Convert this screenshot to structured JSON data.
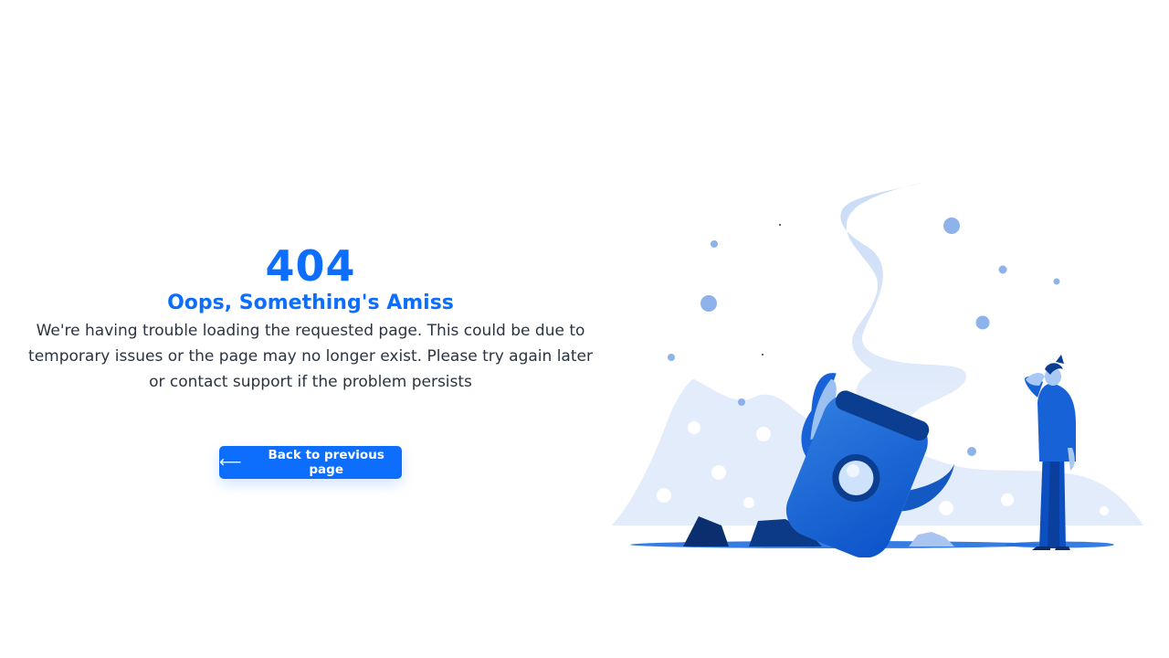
{
  "error": {
    "code": "404",
    "title": "Oops, Something's Amiss",
    "description": "We're having trouble loading the requested page. This could be due to temporary issues or the page may no longer exist. Please try again later or contact support if the problem persists"
  },
  "actions": {
    "back_label": "Back to previous page",
    "back_icon": "arrow-left-icon"
  },
  "illustration": {
    "subject": "crashed-rocket-with-person",
    "colors": {
      "primary": "#0d6efd",
      "dark": "#0b3d91",
      "light": "#cfe0f7",
      "smoke": "#dbe7f8"
    }
  },
  "colors": {
    "accent": "#0d6efd",
    "text": "#2b3441",
    "background": "#ffffff"
  }
}
